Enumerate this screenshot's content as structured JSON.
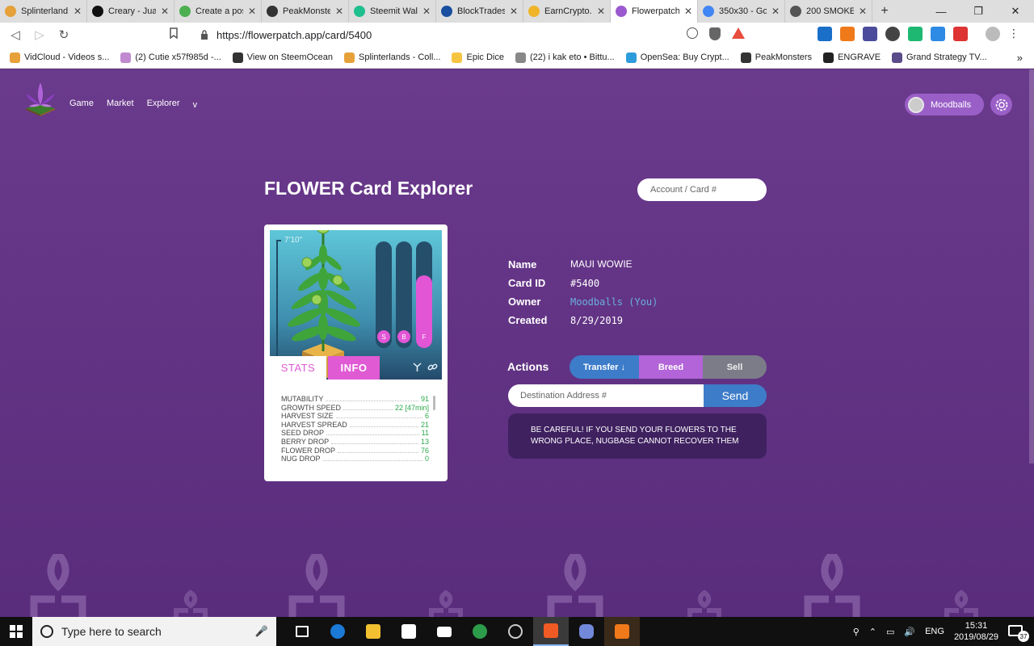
{
  "browser": {
    "tabs": [
      {
        "label": "Splinterland",
        "color": "#e6a13a"
      },
      {
        "label": "Creary - Jua",
        "color": "#111111"
      },
      {
        "label": "Create a pos",
        "color": "#4caf50"
      },
      {
        "label": "PeakMonste",
        "color": "#333333"
      },
      {
        "label": "Steemit Wall",
        "color": "#1fbf8f"
      },
      {
        "label": "BlockTrades",
        "color": "#1a4fa0"
      },
      {
        "label": "EarnCrypto.",
        "color": "#f0b429"
      },
      {
        "label": "Flowerpatch",
        "color": "#9b59d0",
        "active": true
      },
      {
        "label": "350x30 - Go",
        "color": "#4285f4"
      },
      {
        "label": "200 SMOKE",
        "color": "#555555"
      }
    ],
    "url": "https://flowerpatch.app/card/5400",
    "bookmarks": [
      {
        "label": "VidCloud - Videos s...",
        "color": "#e6a13a"
      },
      {
        "label": "(2) Cutie x57f985d -...",
        "color": "#c08ad0"
      },
      {
        "label": "View on SteemOcean",
        "color": "#333333"
      },
      {
        "label": "Splinterlands - Coll...",
        "color": "#e6a13a"
      },
      {
        "label": "Epic Dice",
        "color": "#f5c542"
      },
      {
        "label": "(22) i kak eto • Bittu...",
        "color": "#888888"
      },
      {
        "label": "OpenSea: Buy Crypt...",
        "color": "#2d9cdb"
      },
      {
        "label": "PeakMonsters",
        "color": "#333333"
      },
      {
        "label": "ENGRAVE",
        "color": "#222222"
      },
      {
        "label": "Grand Strategy TV...",
        "color": "#5a4b8a"
      }
    ],
    "bookmarks_more": "»"
  },
  "app": {
    "nav": {
      "game": "Game",
      "market": "Market",
      "explorer": "Explorer",
      "more": "v"
    },
    "user": {
      "name": "Moodballs"
    },
    "title": "FLOWER Card Explorer",
    "search_placeholder": "Account / Card #",
    "card": {
      "height_label": "7'10\"",
      "bars": [
        {
          "label": "S",
          "level": 0.0
        },
        {
          "label": "B",
          "level": 0.0
        },
        {
          "label": "F",
          "level": 0.68
        }
      ],
      "tabs": {
        "stats": "STATS",
        "info": "INFO"
      },
      "stats": [
        {
          "name": "Mutability",
          "value": "91"
        },
        {
          "name": "Growth Speed",
          "value": "22 [47min]"
        },
        {
          "name": "Harvest Size",
          "value": "6"
        },
        {
          "name": "Harvest Spread",
          "value": "21"
        },
        {
          "name": "Seed Drop",
          "value": "11"
        },
        {
          "name": "Berry Drop",
          "value": "13"
        },
        {
          "name": "Flower Drop",
          "value": "76"
        },
        {
          "name": "Nug Drop",
          "value": "0"
        }
      ]
    },
    "details": {
      "name_label": "Name",
      "name": "MAUI WOWIE",
      "id_label": "Card ID",
      "id": "#5400",
      "owner_label": "Owner",
      "owner": "Moodballs (You)",
      "created_label": "Created",
      "created": "8/29/2019"
    },
    "actions": {
      "label": "Actions",
      "transfer": "Transfer ↓",
      "breed": "Breed",
      "sell": "Sell",
      "destination_placeholder": "Destination Address #",
      "send": "Send",
      "warning": "BE CAREFUL! IF YOU SEND YOUR FLOWERS TO THE WRONG PLACE, NUGBASE CANNOT RECOVER THEM"
    }
  },
  "taskbar": {
    "search_placeholder": "Type here to search",
    "time": "15:31",
    "date": "2019/08/29",
    "lang": "ENG",
    "notifications": "37"
  }
}
